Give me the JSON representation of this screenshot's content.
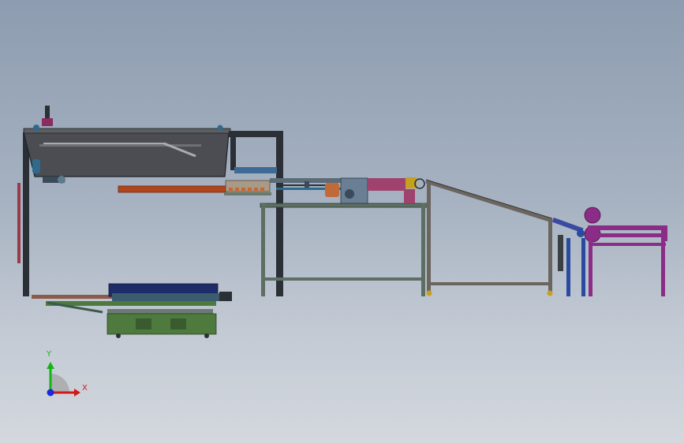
{
  "viewport": {
    "background_top": "#8d9cb0",
    "background_bottom": "#d4d8de"
  },
  "axis_triad": {
    "x_label": "X",
    "y_label": "Y",
    "x_color": "#d01818",
    "y_color": "#14b414",
    "z_color": "#1a2ad8"
  },
  "colors": {
    "frame_dark": "#2a3036",
    "hood_fill": "#4b4d52",
    "table_frame": "#5d6e62",
    "slide_frame": "#6a655f",
    "conveyor_red": "#b0441c",
    "purple": "#8b2c86",
    "blue_post": "#2a4aa0",
    "cart_green": "#4e7a3e",
    "cart_blue": "#1e2d6a"
  }
}
